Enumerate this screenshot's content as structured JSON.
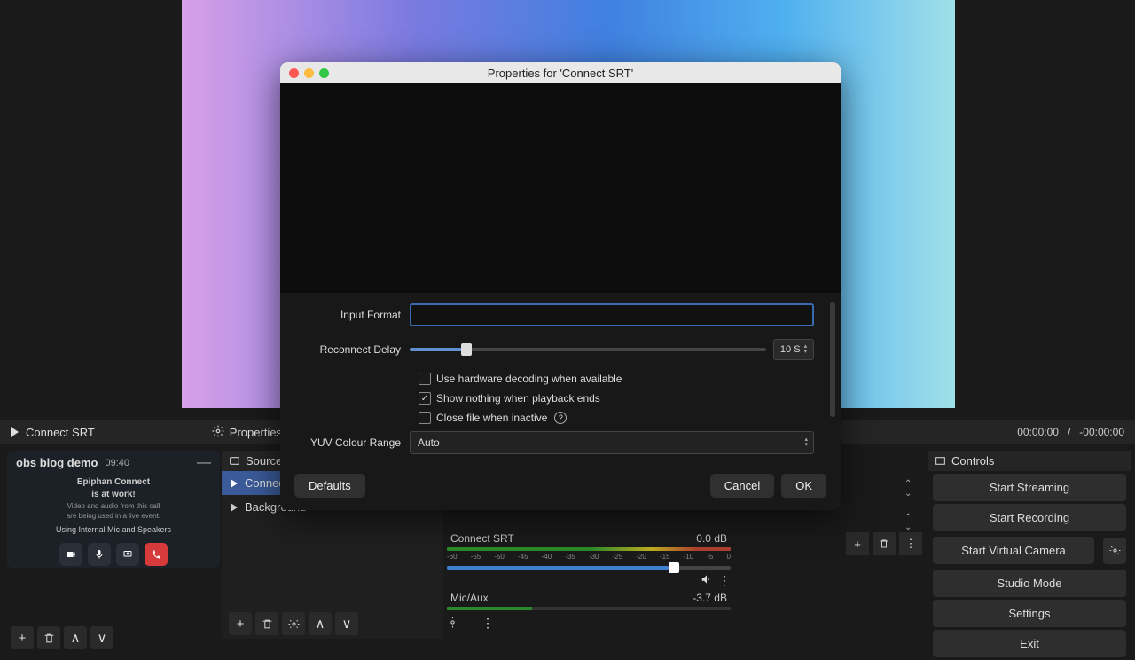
{
  "preview": {},
  "toolbar": {
    "source_name": "Connect SRT",
    "properties_label": "Properties",
    "time_cur": "00:00:00",
    "time_sep": "/",
    "time_rem": "-00:00:00"
  },
  "call": {
    "title": "obs blog demo",
    "time": "09:40",
    "line1": "Epiphan Connect",
    "line2": "is at work!",
    "line3": "Video and audio from this call",
    "line4": "are being used in a live event.",
    "line5": "Using Internal Mic and Speakers"
  },
  "sources": {
    "header": "Sources",
    "items": [
      {
        "label": "Connect SRT",
        "selected": true
      },
      {
        "label": "Background",
        "selected": false
      }
    ]
  },
  "mixer": {
    "ticks": [
      "-60",
      "-55",
      "-50",
      "-45",
      "-40",
      "-35",
      "-30",
      "-25",
      "-20",
      "-15",
      "-10",
      "-5",
      "0"
    ],
    "channels": [
      {
        "name": "Connect SRT",
        "db": "0.0 dB"
      },
      {
        "name": "Mic/Aux",
        "db": "-3.7 dB"
      }
    ]
  },
  "controls": {
    "header": "Controls",
    "items": [
      "Start Streaming",
      "Start Recording",
      "Start Virtual Camera",
      "Studio Mode",
      "Settings",
      "Exit"
    ]
  },
  "modal": {
    "title": "Properties for 'Connect SRT'",
    "input_format_label": "Input Format",
    "input_format_value": "",
    "reconnect_label": "Reconnect Delay",
    "reconnect_value": "10 S",
    "chk_hw": "Use hardware decoding when available",
    "chk_nothing": "Show nothing when playback ends",
    "chk_close": "Close file when inactive",
    "yuv_label": "YUV Colour Range",
    "yuv_value": "Auto",
    "defaults": "Defaults",
    "cancel": "Cancel",
    "ok": "OK"
  }
}
